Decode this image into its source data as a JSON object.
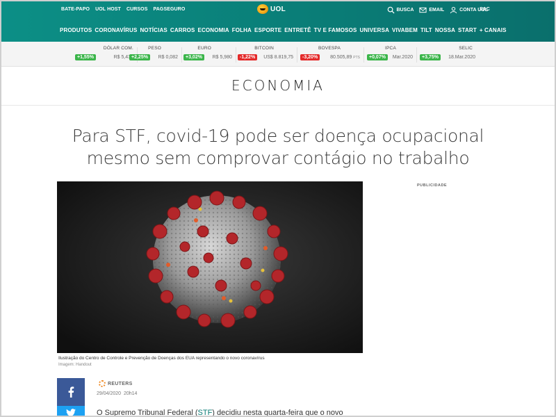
{
  "header": {
    "top_links": [
      "BATE-PAPO",
      "UOL HOST",
      "CURSOS",
      "PAGSEGURO"
    ],
    "logo_text": "UOL",
    "busca": "BUSCA",
    "email": "EMAIL",
    "conta": "CONTA UOL",
    "sac": "SAC",
    "nav": [
      "PRODUTOS",
      "CORONAVÍRUS",
      "NOTÍCIAS",
      "CARROS",
      "ECONOMIA",
      "FOLHA",
      "ESPORTE",
      "ENTRETÊ",
      "TV E FAMOSOS",
      "UNIVERSA",
      "VIVABEM",
      "TILT",
      "NOSSA",
      "START",
      "+ CANAIS"
    ]
  },
  "ticker": [
    {
      "name": "DÓLAR COM.",
      "change": "+1,55%",
      "value": "R$ 5,438",
      "suffix": "",
      "trend": "up"
    },
    {
      "name": "PESO",
      "change": "+2,25%",
      "value": "R$ 0,082",
      "suffix": "",
      "trend": "up"
    },
    {
      "name": "EURO",
      "change": "+3,02%",
      "value": "R$ 5,980",
      "suffix": "",
      "trend": "up"
    },
    {
      "name": "BITCOIN",
      "change": "-1,22%",
      "value": "US$ 8.819,75",
      "suffix": "",
      "trend": "down"
    },
    {
      "name": "BOVESPA",
      "change": "-3,20%",
      "value": "80.505,89",
      "suffix": "PTS",
      "trend": "down"
    },
    {
      "name": "IPCA",
      "change": "+0,07%",
      "value": "Mar.2020",
      "suffix": "",
      "trend": "up"
    },
    {
      "name": "SELIC",
      "change": "+3,75%",
      "value": "18.Mar.2020",
      "suffix": "",
      "trend": "up"
    }
  ],
  "section_title": "ECONOMIA",
  "article": {
    "headline_line1": "Para STF, covid-19 pode ser doença ocupacional",
    "headline_line2": "mesmo sem comprovar contágio no trabalho",
    "caption": "Ilustração do Centro de Controle e Prevenção de Doenças dos EUA representando o novo coronavírus",
    "credit": "Imagem: Handout",
    "ad_label": "PUBLICIDADE",
    "source": "REUTERS",
    "date": "29/04/2020",
    "time": "20h14",
    "body_prefix": "O Supremo Tribunal Federal (",
    "body_link": "STF",
    "body_suffix": ") decidiu nesta quarta-feira que o novo"
  },
  "colors": {
    "brand_teal": "#0a7c76",
    "up": "#3bb54a",
    "down": "#e42a2a",
    "facebook": "#3b5998",
    "twitter": "#1da1f2"
  }
}
